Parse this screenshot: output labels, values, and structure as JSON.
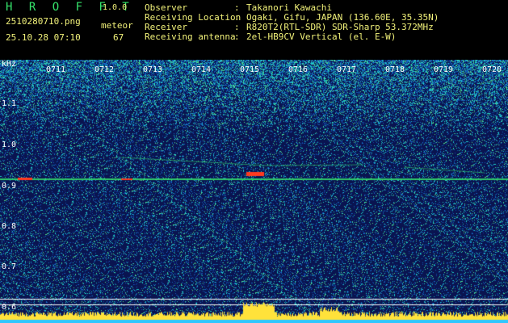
{
  "header": {
    "app_title": "H R O F F T",
    "app_version": "1.0.0",
    "filename": "2510280710.png",
    "datetime": "25.10.28 07:10",
    "meteor_label": "meteor",
    "meteor_count": "67",
    "info": [
      {
        "key": "Observer",
        "value": "Takanori Kawachi"
      },
      {
        "key": "Receiving Location",
        "value": "Ogaki, Gifu, JAPAN (136.60E, 35.35N)"
      },
      {
        "key": "Receiver",
        "value": "R820T2(RTL-SDR) SDR-Sharp 53.372MHz"
      },
      {
        "key": "Receiving antenna",
        "value": "2el-HB9CV Vertical (el. E-W)"
      }
    ]
  },
  "spectrogram": {
    "y_unit": "kHz",
    "y_ticks": [
      "1.1",
      "1.0",
      "0.9",
      "0.8",
      "0.7",
      "0.6"
    ],
    "time_ticks": [
      "0711",
      "0712",
      "0713",
      "0714",
      "0715",
      "0716",
      "0717",
      "0718",
      "0719",
      "0720"
    ],
    "colors": {
      "background": "#0a1450",
      "carrier": "#35e36b",
      "echo": "#ff3a20",
      "baseline": "#ffe23a"
    }
  }
}
